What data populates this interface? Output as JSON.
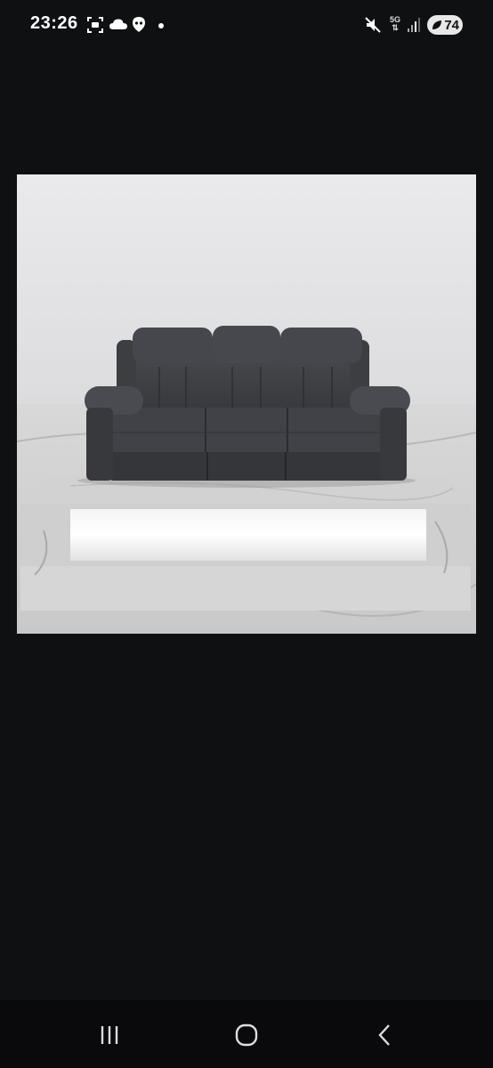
{
  "status_bar": {
    "time": "23:26",
    "network": "5G",
    "battery": "74",
    "icons": [
      "screenshot-icon",
      "cloud-icon",
      "location-icon",
      "dot-icon",
      "mute-icon",
      "network-5g-icon",
      "signal-icon",
      "battery-icon"
    ]
  },
  "image": {
    "subject": "sofa-photo"
  },
  "nav_bar": {
    "buttons": [
      "recent-apps-button",
      "home-button",
      "back-button"
    ]
  }
}
